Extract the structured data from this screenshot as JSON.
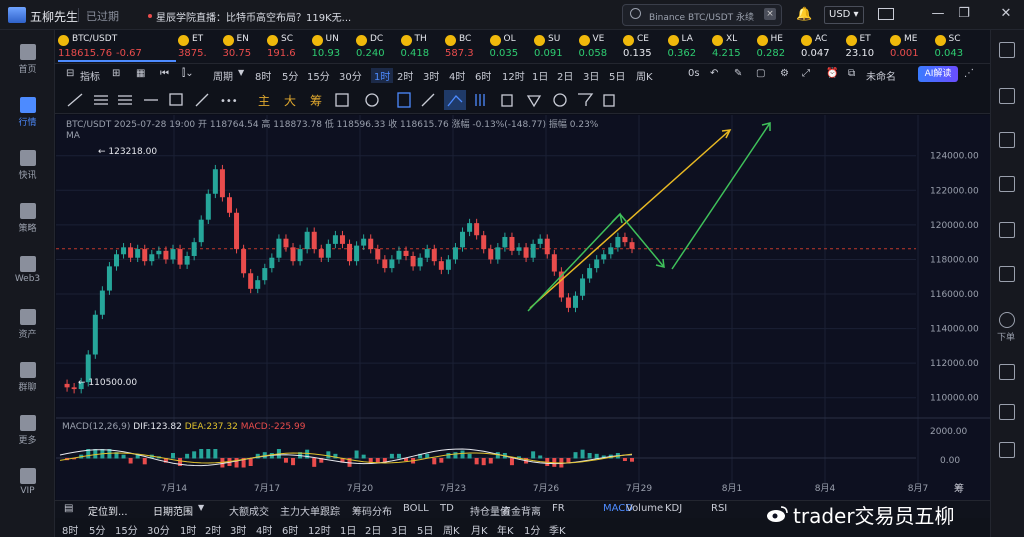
{
  "titlebar": {
    "app_name": "五柳先生",
    "expired": "已过期",
    "news": "星辰学院直播：比特币高空布局？119K无...",
    "search_text": "Binance BTC/USDT 永续",
    "currency": "USD ▾"
  },
  "sidebar": {
    "items": [
      {
        "label": "首页",
        "icon": "home-icon"
      },
      {
        "label": "行情",
        "icon": "market-chart-icon"
      },
      {
        "label": "快讯",
        "icon": "news-flash-icon"
      },
      {
        "label": "策略",
        "icon": "strategy-robot-icon"
      },
      {
        "label": "Web3",
        "icon": "web3-icon"
      },
      {
        "label": "资产",
        "icon": "wallet-icon"
      },
      {
        "label": "群聊",
        "icon": "chat-icon"
      },
      {
        "label": "更多",
        "icon": "more-grid-icon"
      },
      {
        "label": "VIP",
        "icon": "vip-crown-icon"
      }
    ]
  },
  "right_sidebar": {
    "download_label": "下单"
  },
  "ticker": {
    "first": {
      "symbol": "BTC/USDT",
      "price": "118615.76",
      "change": "-0.67"
    },
    "items": [
      {
        "sym": "ET",
        "val": "3875.",
        "dir": "down"
      },
      {
        "sym": "EN",
        "val": "30.75",
        "dir": "down"
      },
      {
        "sym": "SC",
        "val": "191.6",
        "dir": "down"
      },
      {
        "sym": "UN",
        "val": "10.93",
        "dir": "up"
      },
      {
        "sym": "DC",
        "val": "0.240",
        "dir": "up"
      },
      {
        "sym": "TH",
        "val": "0.418",
        "dir": "up"
      },
      {
        "sym": "BC",
        "val": "587.3",
        "dir": "down"
      },
      {
        "sym": "OL",
        "val": "0.035",
        "dir": "up"
      },
      {
        "sym": "SU",
        "val": "0.091",
        "dir": "up"
      },
      {
        "sym": "VE",
        "val": "0.058",
        "dir": "up"
      },
      {
        "sym": "CE",
        "val": "0.135",
        "dir": "wh"
      },
      {
        "sym": "LA",
        "val": "0.362",
        "dir": "up"
      },
      {
        "sym": "XL",
        "val": "4.215",
        "dir": "up"
      },
      {
        "sym": "HE",
        "val": "0.282",
        "dir": "up"
      },
      {
        "sym": "AC",
        "val": "0.047",
        "dir": "wh"
      },
      {
        "sym": "ET",
        "val": "23.10",
        "dir": "wh"
      },
      {
        "sym": "ME",
        "val": "0.001",
        "dir": "down"
      },
      {
        "sym": "SC",
        "val": "0.043",
        "dir": "up"
      }
    ]
  },
  "toolbar1": {
    "indicators": "指标",
    "period": "周期",
    "intervals": [
      "8时",
      "5分",
      "15分",
      "30分",
      "1时",
      "2时",
      "3时",
      "4时",
      "6时",
      "12时",
      "1日",
      "2日",
      "3日",
      "5日",
      "周K"
    ],
    "active_interval": "1时",
    "timer": "0s",
    "unnamed": "未命名",
    "ai": "AI解读"
  },
  "toolbar2": {
    "labels": [
      "主",
      "大",
      "筹"
    ]
  },
  "chart": {
    "info": "BTC/USDT  2025-07-28 19:00  开 118764.54  高 118873.78  低 118596.33  收 118615.76  涨幅 -0.13%(-148.77)  振幅 0.23%",
    "ma": "MA",
    "high_marker": "← 123218.00",
    "low_marker": "← 110500.00",
    "macd": {
      "name": "MACD(12,26,9)",
      "dif": "DIF:123.82",
      "dea": "DEA:237.32",
      "macd": "MACD:-225.99"
    },
    "watermark": "trader交易员五柳"
  },
  "chart_data": {
    "type": "line",
    "title": "BTC/USDT",
    "x_ticks": [
      "7月14",
      "7月17",
      "7月20",
      "7月23",
      "7月26",
      "7月29",
      "8月1",
      "8月4",
      "8月7"
    ],
    "y_ticks": [
      110000,
      112000,
      114000,
      116000,
      118000,
      120000,
      122000,
      124000
    ],
    "ylim": [
      109000,
      125200
    ],
    "current_price": 118615.76,
    "series": [
      {
        "values": [
          110800,
          110600,
          110500,
          110900,
          112500,
          114800,
          116200,
          117600,
          118300,
          118700,
          118100,
          118600,
          117900,
          118300,
          118500,
          118000,
          118600,
          117700,
          118200,
          119000,
          120300,
          121800,
          123218,
          121600,
          120700,
          118600,
          117200,
          116300,
          116800,
          117500,
          118100,
          119200,
          118700,
          117900,
          118600,
          119600,
          118600,
          118100,
          118900,
          119400,
          118900,
          117900,
          118800,
          119200,
          118600,
          118000,
          117500,
          118000,
          118500,
          118200,
          117600,
          118100,
          118600,
          117900,
          117400,
          118000,
          118700,
          119600,
          120100,
          119400,
          118600,
          118000,
          118700,
          119300,
          118500,
          118700,
          118100,
          118900,
          119200,
          118300,
          117300,
          115800,
          115200,
          115900,
          116900,
          117500,
          118000,
          118300,
          118700,
          119300,
          119000,
          118615
        ]
      }
    ],
    "macd_yticks": [
      "2000.00",
      "0.00"
    ],
    "annotations": [
      "123218.00",
      "110500.00"
    ]
  },
  "bottom1": {
    "locate": "定位到...",
    "date_range": "日期范围",
    "items": [
      "大额成交",
      "主力大单跟踪",
      "筹码分布",
      "BOLL",
      "TD",
      "持仓量值",
      "资金背离",
      "FR",
      "MACD",
      "Volume",
      "KDJ",
      "RSI"
    ],
    "active": "MACD"
  },
  "bottom2": {
    "items": [
      "8时",
      "5分",
      "15分",
      "30分",
      "1时",
      "2时",
      "3时",
      "4时",
      "6时",
      "12时",
      "1日",
      "2日",
      "3日",
      "5日",
      "周K",
      "月K",
      "年K",
      "1分",
      "季K"
    ]
  },
  "axis_corner": "筹"
}
